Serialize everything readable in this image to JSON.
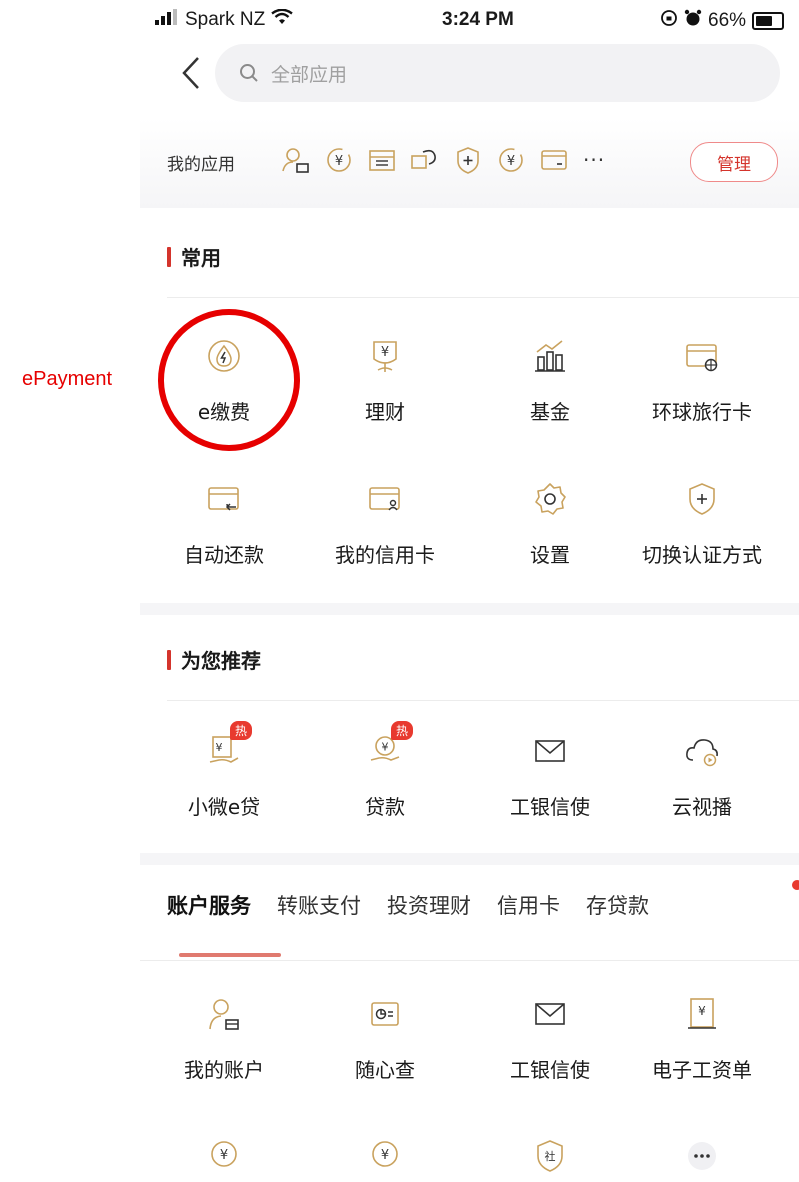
{
  "annotation": {
    "label": "ePayment"
  },
  "status_bar": {
    "carrier": "Spark NZ",
    "time": "3:24 PM",
    "battery": "66%"
  },
  "search": {
    "placeholder": "全部应用"
  },
  "my_apps": {
    "label": "我的应用",
    "more": "···",
    "manage_label": "管理"
  },
  "common": {
    "title": "常用",
    "items": [
      {
        "label": "e缴费",
        "icon": "drop-bolt-icon"
      },
      {
        "label": "理财",
        "icon": "yuan-plant-icon"
      },
      {
        "label": "基金",
        "icon": "chart-icon"
      },
      {
        "label": "环球旅行卡",
        "icon": "card-globe-icon"
      },
      {
        "label": "自动还款",
        "icon": "card-return-icon"
      },
      {
        "label": "我的信用卡",
        "icon": "card-user-icon"
      },
      {
        "label": "设置",
        "icon": "gear-icon"
      },
      {
        "label": "切换认证方式",
        "icon": "shield-plus-icon"
      }
    ]
  },
  "recommend": {
    "title": "为您推荐",
    "items": [
      {
        "label": "小微e贷",
        "icon": "loan-hand-icon",
        "badge": "热"
      },
      {
        "label": "贷款",
        "icon": "coin-hand-icon",
        "badge": "热"
      },
      {
        "label": "工银信使",
        "icon": "mail-icon"
      },
      {
        "label": "云视播",
        "icon": "cloud-play-icon"
      }
    ]
  },
  "tabs": [
    "账户服务",
    "转账支付",
    "投资理财",
    "信用卡",
    "存贷款"
  ],
  "account_services": {
    "items": [
      {
        "label": "我的账户",
        "icon": "user-card-icon"
      },
      {
        "label": "随心查",
        "icon": "search-card-icon"
      },
      {
        "label": "工银信使",
        "icon": "mail-icon"
      },
      {
        "label": "电子工资单",
        "icon": "payslip-icon"
      },
      {
        "label": "",
        "icon": "coin-icon"
      },
      {
        "label": "",
        "icon": "coin-icon"
      },
      {
        "label": "",
        "icon": "shield-she-icon"
      },
      {
        "label": "",
        "icon": "more-icon"
      }
    ]
  },
  "colors": {
    "accent": "#d4342c",
    "gold": "#c9a25e",
    "annotation": "#e60000"
  }
}
